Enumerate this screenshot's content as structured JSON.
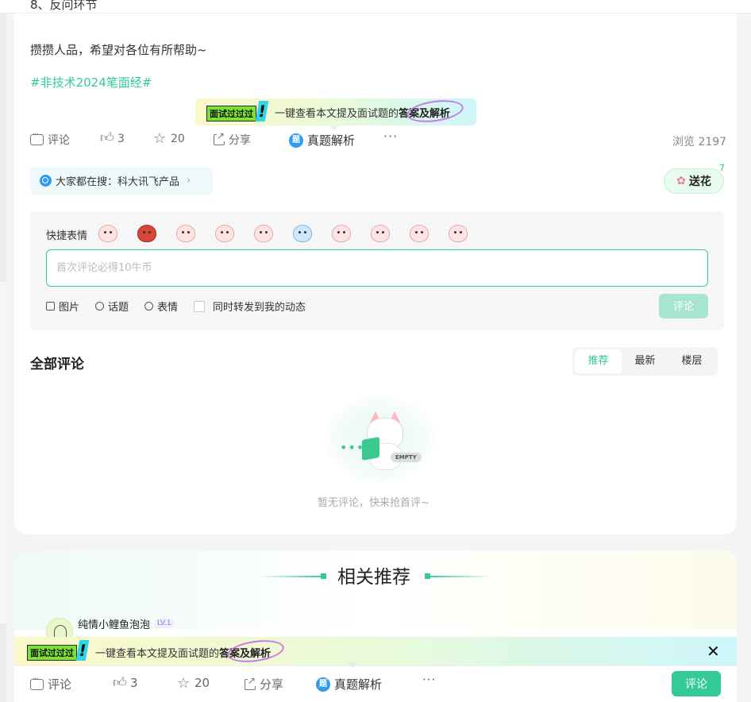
{
  "top_strip": {
    "text": "8、反问环节"
  },
  "post": {
    "paragraph": "攒攒人品，希望对各位有所帮助~",
    "hashtag": "#非技术2024笔面经#"
  },
  "promo": {
    "badge": "面试过过过",
    "excl": "!",
    "text_prefix": "一键查看本文提及面试题的",
    "text_highlight": "答案及解析"
  },
  "actions": {
    "comment": "评论",
    "like_count": "3",
    "star_count": "20",
    "share": "分享",
    "ti_icon": "题",
    "zhenti": "真题解析",
    "more": "···",
    "views": "浏览 2197"
  },
  "search_tag": {
    "text": "大家都在搜：科大讯飞产品",
    "chevron": "›"
  },
  "flower": {
    "icon": "flower-icon",
    "label": "送花",
    "count": "7"
  },
  "editor": {
    "quick_label": "快捷表情",
    "emoji_count": 10,
    "placeholder": "首次评论必得10牛币",
    "tools": {
      "image": "图片",
      "topic": "话题",
      "emoji": "表情",
      "repost": "同时转发到我的动态"
    },
    "submit": "评论"
  },
  "comments": {
    "title": "全部评论",
    "sort": [
      "推荐",
      "最新",
      "楼层"
    ],
    "active_sort": "推荐",
    "empty_tag": "EMPTY",
    "empty_text": "暂无评论，快来抢首评~",
    "dots": "•••"
  },
  "recommend": {
    "title": "相关推荐",
    "user": {
      "name": "纯情小鲤鱼泡泡",
      "level": "LV.1"
    }
  },
  "bottom_bar": {
    "comment": "评论",
    "like_count": "3",
    "star_count": "20",
    "share": "分享",
    "zhenti": "真题解析",
    "more": "···",
    "comment_button": "评论",
    "close": "✕"
  },
  "colors": {
    "accent": "#32ca99",
    "accent_light": "#a6e6cf",
    "link_blue": "#2f9cf2"
  }
}
